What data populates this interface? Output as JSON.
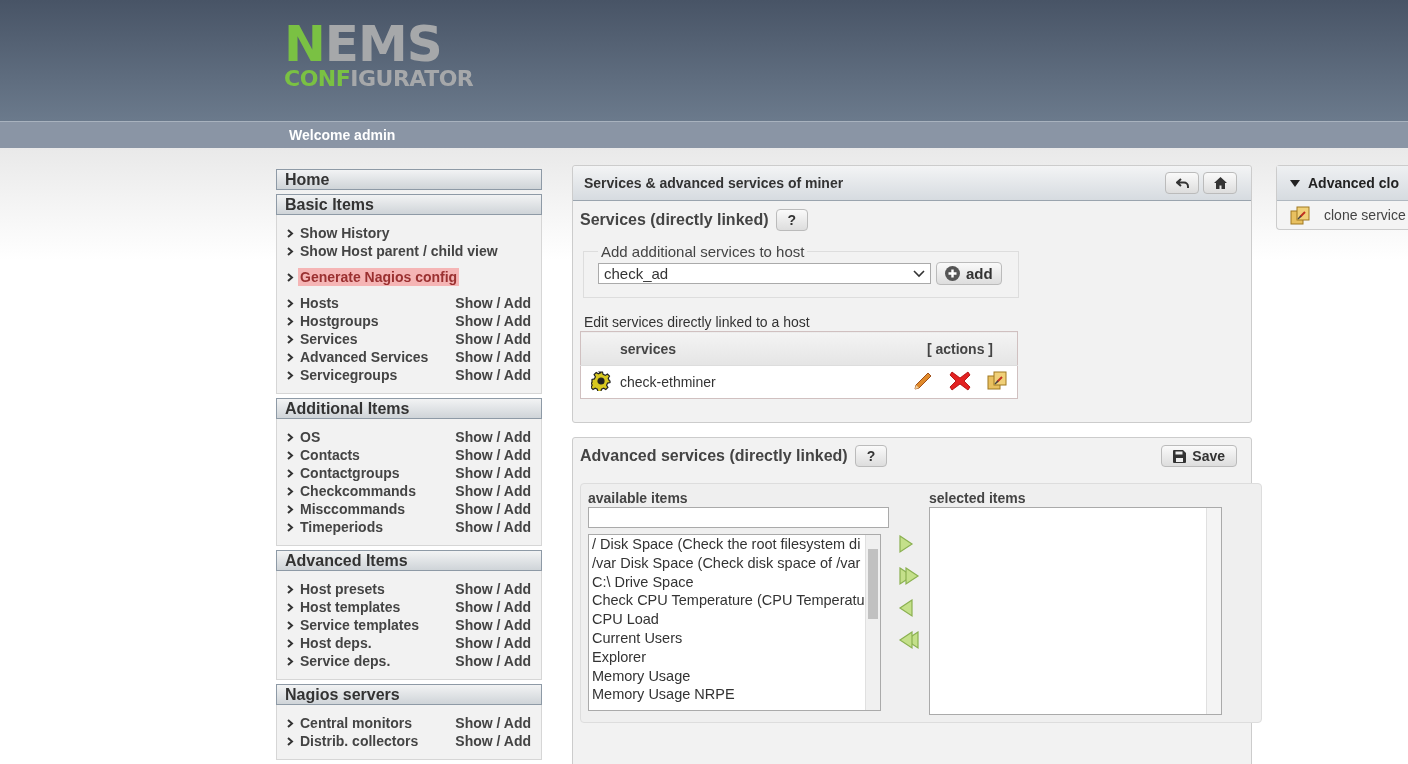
{
  "header": {
    "logo": {
      "top": [
        {
          "text": "N",
          "accent": true
        },
        {
          "text": "EMS",
          "accent": false
        }
      ],
      "bottom": [
        {
          "text": "CONF",
          "accent": true
        },
        {
          "text": "IGURATOR",
          "accent": false
        }
      ]
    },
    "welcome": "Welcome admin"
  },
  "sidebar": {
    "sections": [
      {
        "title": "Home"
      },
      {
        "title": "Basic Items",
        "groups": [
          {
            "items": [
              {
                "label": "Show History",
                "highlighted": false
              },
              {
                "label": "Show Host parent / child view",
                "highlighted": false
              }
            ]
          },
          {
            "items": [
              {
                "label": "Generate Nagios config",
                "highlighted": true
              }
            ]
          },
          {
            "items": [
              {
                "label": "Hosts",
                "actions": "Show / Add",
                "highlighted": false
              },
              {
                "label": "Hostgroups",
                "actions": "Show / Add",
                "highlighted": false
              },
              {
                "label": "Services",
                "actions": "Show / Add",
                "highlighted": false
              },
              {
                "label": "Advanced Services",
                "actions": "Show / Add",
                "highlighted": false
              },
              {
                "label": "Servicegroups",
                "actions": "Show / Add",
                "highlighted": false
              }
            ]
          }
        ]
      },
      {
        "title": "Additional Items",
        "groups": [
          {
            "items": [
              {
                "label": "OS",
                "actions": "Show / Add",
                "highlighted": false
              },
              {
                "label": "Contacts",
                "actions": "Show / Add",
                "highlighted": false
              },
              {
                "label": "Contactgroups",
                "actions": "Show / Add",
                "highlighted": false
              },
              {
                "label": "Checkcommands",
                "actions": "Show / Add",
                "highlighted": false
              },
              {
                "label": "Misccommands",
                "actions": "Show / Add",
                "highlighted": false
              },
              {
                "label": "Timeperiods",
                "actions": "Show / Add",
                "highlighted": false
              }
            ]
          }
        ]
      },
      {
        "title": "Advanced Items",
        "groups": [
          {
            "items": [
              {
                "label": "Host presets",
                "actions": "Show / Add",
                "highlighted": false
              },
              {
                "label": "Host templates",
                "actions": "Show / Add",
                "highlighted": false
              },
              {
                "label": "Service templates",
                "actions": "Show / Add",
                "highlighted": false
              },
              {
                "label": "Host deps.",
                "actions": "Show / Add",
                "highlighted": false
              },
              {
                "label": "Service deps.",
                "actions": "Show / Add",
                "highlighted": false
              }
            ]
          }
        ]
      },
      {
        "title": "Nagios servers",
        "groups": [
          {
            "items": [
              {
                "label": "Central monitors",
                "actions": "Show / Add",
                "highlighted": false
              },
              {
                "label": "Distrib. collectors",
                "actions": "Show / Add",
                "highlighted": false
              }
            ]
          }
        ]
      }
    ]
  },
  "services_panel": {
    "title": "Services & advanced services of miner",
    "section_title": "Services (directly linked)",
    "help": "?",
    "add_box": {
      "legend": "Add additional services to host",
      "select_value": "check_ad",
      "add_label": "add"
    },
    "table": {
      "caption": "Edit services directly linked to a host",
      "columns": [
        "services",
        "[ actions ]"
      ],
      "rows": [
        {
          "name": "check-ethminer"
        }
      ]
    }
  },
  "advanced_panel": {
    "title": "Advanced services (directly linked)",
    "help": "?",
    "save_label": "Save",
    "available_label": "available items",
    "selected_label": "selected items",
    "available_items": [
      "/ Disk Space (Check the root filesystem di",
      "/var Disk Space (Check disk space of /var",
      "C:\\ Drive Space",
      "Check CPU Temperature (CPU Temperatu",
      "CPU Load",
      "Current Users",
      "Explorer",
      "Memory Usage",
      "Memory Usage NRPE"
    ]
  },
  "clone_panel": {
    "title": "Advanced clo",
    "expanded": true,
    "items": [
      {
        "label": "clone service"
      }
    ]
  }
}
